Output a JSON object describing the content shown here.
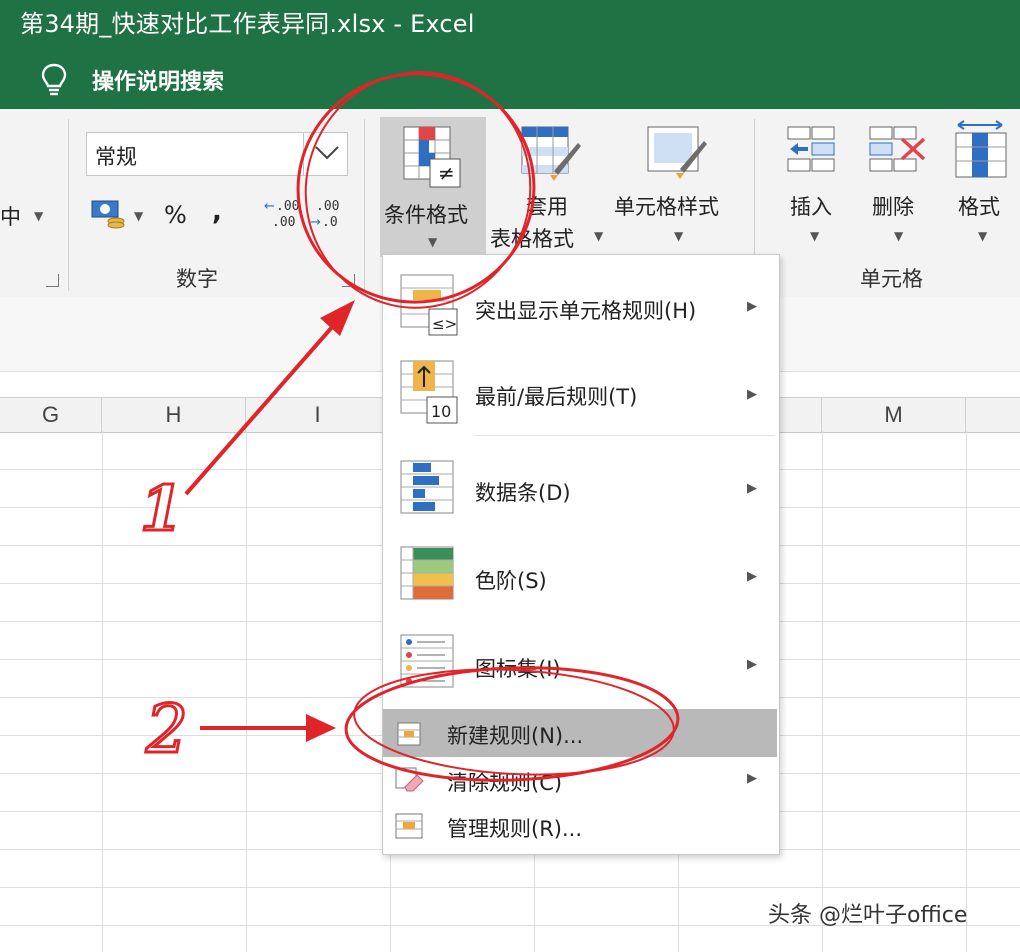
{
  "window": {
    "title": "第34期_快速对比工作表异同.xlsx  -  Excel",
    "tell_me": "操作说明搜索"
  },
  "ribbon": {
    "align_partial": "中",
    "number_format_value": "常规",
    "percent_symbol": "%",
    "comma_symbol": ",",
    "dec_increase": ".00",
    "dec_decrease": ".00",
    "number_group_label": "数字",
    "conditional_formatting": "条件格式",
    "format_as_table_line1": "套用",
    "format_as_table_line2": "表格格式",
    "cell_styles": "单元格样式",
    "insert": "插入",
    "delete": "删除",
    "format": "格式",
    "cells_group_label": "单元格"
  },
  "columns": [
    "G",
    "H",
    "I",
    "M"
  ],
  "menu": {
    "items": [
      {
        "label": "突出显示单元格规则(H)",
        "submenu": true
      },
      {
        "label": "最前/最后规则(T)",
        "submenu": true
      },
      {
        "label": "数据条(D)",
        "submenu": true
      },
      {
        "label": "色阶(S)",
        "submenu": true
      },
      {
        "label": "图标集(I)",
        "submenu": true
      },
      {
        "label": "新建规则(N)...",
        "submenu": false,
        "highlighted": true
      },
      {
        "label": "清除规则(C)",
        "submenu": true
      },
      {
        "label": "管理规则(R)...",
        "submenu": false
      }
    ],
    "icon_text_le": "≤>",
    "icon_text_10": "10"
  },
  "annotations": {
    "step1": "1",
    "step2": "2"
  },
  "watermark": "头条 @烂叶子office",
  "colors": {
    "excel_green": "#1f7244",
    "annotation_red": "#e0252a",
    "highlight": "#b9b9b9"
  }
}
